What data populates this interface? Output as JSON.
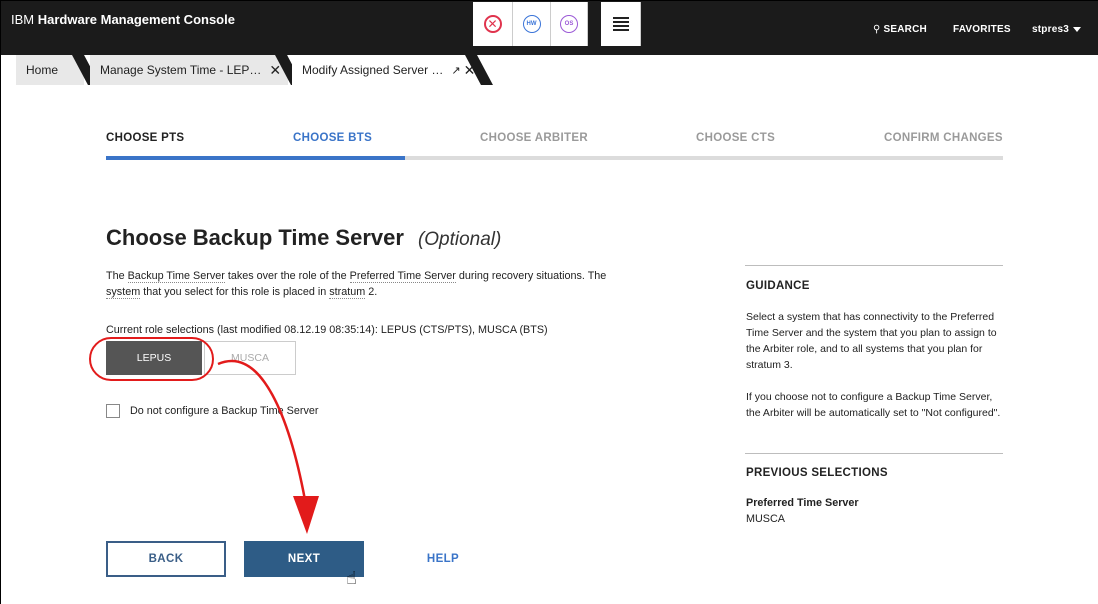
{
  "header": {
    "brand_prefix": "IBM",
    "brand_name": "Hardware Management Console",
    "search_label": "SEARCH",
    "favorites_label": "FAVORITES",
    "user_label": "stpres3"
  },
  "status_icons": {
    "hw_label": "HW",
    "os_label": "OS"
  },
  "tabs": [
    {
      "label": "Home"
    },
    {
      "label": "Manage System Time - LEP…"
    },
    {
      "label": "Modify Assigned Server …"
    }
  ],
  "steps": [
    {
      "label": "CHOOSE PTS",
      "state": "done"
    },
    {
      "label": "CHOOSE BTS",
      "state": "current"
    },
    {
      "label": "CHOOSE ARBITER",
      "state": "todo"
    },
    {
      "label": "CHOOSE CTS",
      "state": "todo"
    },
    {
      "label": "CONFIRM CHANGES",
      "state": "todo"
    }
  ],
  "main": {
    "title": "Choose Backup Time Server",
    "optional": "(Optional)",
    "desc_1": "The ",
    "desc_bts": "Backup Time Server",
    "desc_2": " takes over the role of the ",
    "desc_pts": "Preferred Time Server",
    "desc_3": " during recovery situations. The ",
    "desc_system": "system",
    "desc_4": " that you select for this role is placed in ",
    "desc_stratum": "stratum",
    "desc_5": " 2.",
    "current_selections": "Current role selections (last modified 08.12.19 08:35:14): LEPUS (CTS/PTS), MUSCA (BTS)",
    "choices": [
      "LEPUS",
      "MUSCA"
    ],
    "selected_choice": "LEPUS",
    "checkbox_label": "Do not configure a Backup Time Server",
    "checkbox_checked": false
  },
  "buttons": {
    "back": "BACK",
    "next": "NEXT",
    "help": "HELP"
  },
  "guidance": {
    "heading": "GUIDANCE",
    "para1": "Select a system that has connectivity to the Preferred Time Server and the system that you plan to assign to the Arbiter role, and to all systems that you plan for stratum 3.",
    "para2": "If you choose not to configure a Backup Time Server, the Arbiter will be automatically set to \"Not configured\".",
    "prev_heading": "PREVIOUS SELECTIONS",
    "prev_label": "Preferred Time Server",
    "prev_value": "MUSCA"
  },
  "colors": {
    "accent": "#3a74c8",
    "primary_button": "#2e5c86",
    "annotation": "#e21b1b"
  }
}
